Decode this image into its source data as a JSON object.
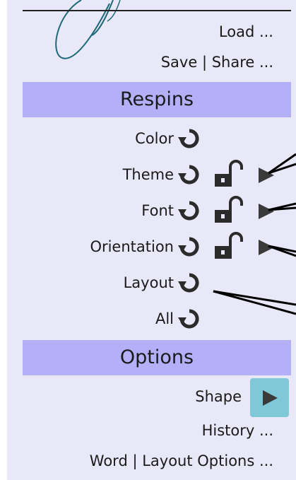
{
  "menu": {
    "load": "Load ...",
    "save_share": "Save | Share ..."
  },
  "respins": {
    "header": "Respins",
    "items": [
      {
        "label": "Color",
        "lockable": false,
        "expandable": false
      },
      {
        "label": "Theme",
        "lockable": true,
        "expandable": true
      },
      {
        "label": "Font",
        "lockable": true,
        "expandable": true
      },
      {
        "label": "Orientation",
        "lockable": true,
        "expandable": true
      },
      {
        "label": "Layout",
        "lockable": false,
        "expandable": false
      },
      {
        "label": "All",
        "lockable": false,
        "expandable": false
      }
    ]
  },
  "options": {
    "header": "Options",
    "shape": "Shape",
    "history": "History ...",
    "word_layout": "Word | Layout Options ..."
  },
  "colors": {
    "panel_bg": "#e8e8f8",
    "header_bg": "#b4b0f8",
    "shape_button_bg": "#7ec8d8",
    "logo_stroke": "#1f6a78",
    "icon": "#2b2b2b"
  },
  "icons": {
    "respin": "rotate-ccw-icon",
    "lock": "unlocked-padlock-icon",
    "expand": "play-triangle-icon"
  }
}
